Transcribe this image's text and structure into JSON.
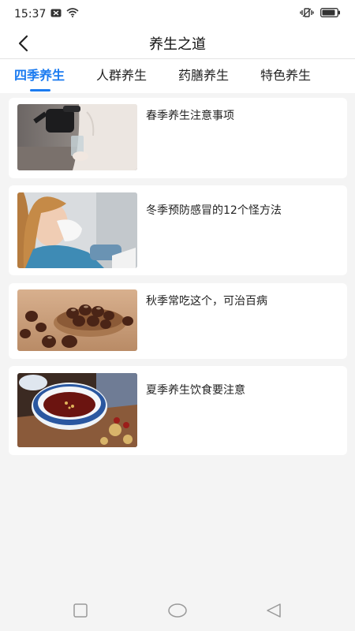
{
  "status_bar": {
    "time": "15:37"
  },
  "header": {
    "title": "养生之道"
  },
  "tabs": [
    {
      "label": "四季养生",
      "active": true
    },
    {
      "label": "人群养生",
      "active": false
    },
    {
      "label": "药膳养生",
      "active": false
    },
    {
      "label": "特色养生",
      "active": false
    }
  ],
  "articles": [
    {
      "title": "春季养生注意事项"
    },
    {
      "title": "冬季预防感冒的12个怪方法"
    },
    {
      "title": "秋季常吃这个，可治百病"
    },
    {
      "title": "夏季养生饮食要注意"
    }
  ],
  "colors": {
    "accent": "#1b7bf0",
    "background": "#f4f4f4",
    "card": "#ffffff"
  }
}
